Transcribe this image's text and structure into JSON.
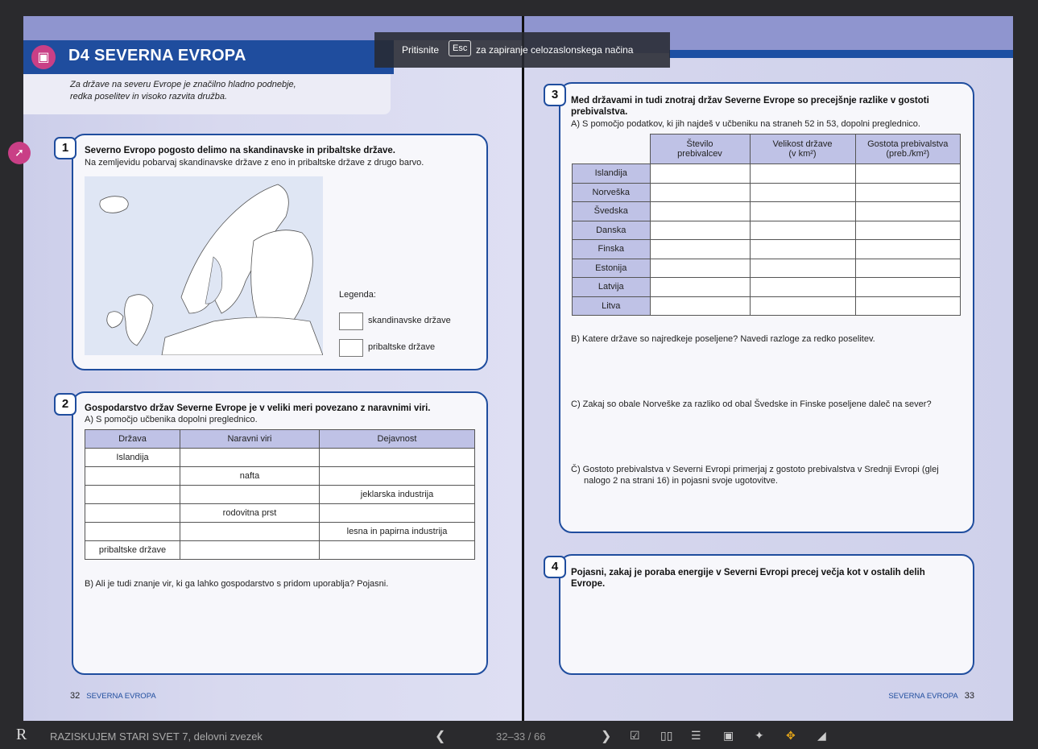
{
  "fullscreen_toast": {
    "prefix": "Pritisnite",
    "key": "Esc",
    "suffix": "za zapiranje celozaslonskega načina"
  },
  "left_page": {
    "section_title": "D4 SEVERNA EVROPA",
    "intro_line1": "Za države na severu Evrope je značilno hladno podnebje,",
    "intro_line2": "redka poselitev in visoko razvita družba.",
    "task1": {
      "number": "1",
      "title": "Severno Evropo pogosto delimo na skandinavske in pribaltske države.",
      "text": "Na zemljevidu pobarvaj skandinavske države z eno in pribaltske države z drugo barvo.",
      "legend_title": "Legenda:",
      "legend_items": [
        "skandinavske države",
        "pribaltske države"
      ]
    },
    "task2": {
      "number": "2",
      "title": "Gospodarstvo držav Severne Evrope je v veliki meri povezano z naravnimi viri.",
      "part_a": "A) S pomočjo učbenika dopolni preglednico.",
      "columns": [
        "Država",
        "Naravni viri",
        "Dejavnost"
      ],
      "rows": [
        [
          "Islandija",
          "",
          ""
        ],
        [
          "",
          "nafta",
          ""
        ],
        [
          "",
          "",
          "jeklarska industrija"
        ],
        [
          "",
          "rodovitna prst",
          ""
        ],
        [
          "",
          "",
          "lesna in papirna industrija"
        ],
        [
          "pribaltske države",
          "",
          ""
        ]
      ],
      "part_b": "B) Ali je tudi znanje vir, ki ga lahko gospodarstvo s pridom uporablja? Pojasni."
    },
    "page_number": "32",
    "running_head": "SEVERNA EVROPA"
  },
  "right_page": {
    "task3": {
      "number": "3",
      "title_line1": "Med državami in tudi znotraj držav Severne Evrope so precejšnje razlike v gostoti",
      "title_line2": "prebivalstva.",
      "part_a": "A) S pomočjo podatkov, ki jih najdeš v učbeniku na straneh 52 in 53, dopolni preglednico.",
      "columns": [
        {
          "line1": "Število",
          "line2": "prebivalcev"
        },
        {
          "line1": "Velikost države",
          "line2": "(v km²)"
        },
        {
          "line1": "Gostota prebivalstva",
          "line2": "(preb./km²)"
        }
      ],
      "countries": [
        "Islandija",
        "Norveška",
        "Švedska",
        "Danska",
        "Finska",
        "Estonija",
        "Latvija",
        "Litva"
      ],
      "part_b": "B) Katere države so najredkeje poseljene? Navedi razloge za redko poselitev.",
      "part_c": "C) Zakaj so obale Norveške za razliko od obal Švedske in Finske poseljene daleč na sever?",
      "part_d_line1": "Č) Gostoto prebivalstva v Severni Evropi primerjaj z gostoto prebivalstva v Srednji Evropi (glej",
      "part_d_line2": "nalogo 2 na strani 16) in pojasni svoje ugotovitve."
    },
    "task4": {
      "number": "4",
      "title_line1": "Pojasni, zakaj je poraba energije v Severni Evropi precej večja kot v ostalih delih",
      "title_line2": "Evrope."
    },
    "page_number": "33",
    "running_head": "SEVERNA EVROPA"
  },
  "bottom_bar": {
    "logo": "R",
    "book_title": "RAZISKUJEM STARI SVET 7, delovni zvezek",
    "pager": "32–33 / 66",
    "tools": [
      "checkbox-icon",
      "two-page-icon",
      "list-icon",
      "briefcase-icon",
      "magic-wand-icon",
      "move-icon",
      "megaphone-icon"
    ]
  },
  "colors": {
    "brand_blue": "#1f4d9e",
    "accent_pink": "#c93f86",
    "table_header": "#bfc2e6",
    "active_tool": "#e0a21a"
  }
}
